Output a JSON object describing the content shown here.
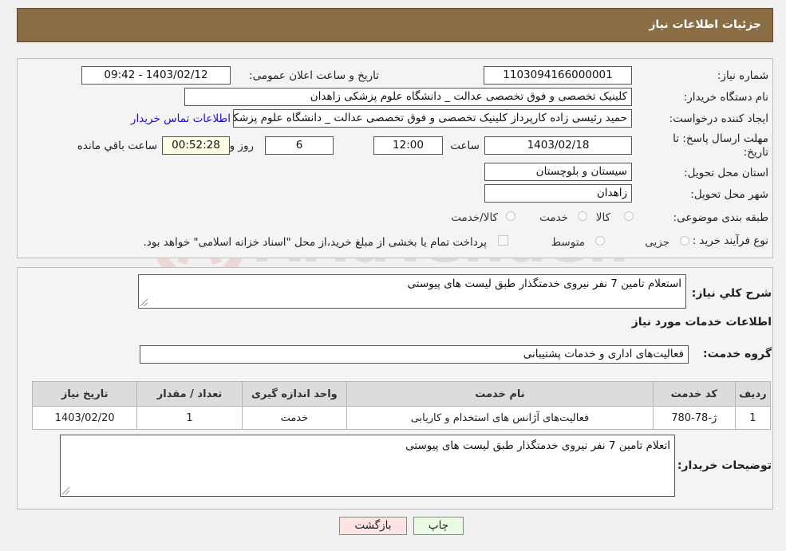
{
  "header": {
    "title": "جزئیات اطلاعات نیاز"
  },
  "form": {
    "need_number_label": "شماره نیاز:",
    "need_number": "1103094166000001",
    "announce_label": "تاریخ و ساعت اعلان عمومی:",
    "announce_value": "1403/02/12 - 09:42",
    "buyer_org_label": "نام دستگاه خریدار:",
    "buyer_org": "کلینیک تخصصی و فوق تخصصی عدالت _ دانشگاه علوم پزشکی زاهدان",
    "creator_label": "ایجاد کننده درخواست:",
    "creator": "حمید رئیسی زاده کارپرداز کلینیک تخصصی و فوق تخصصی عدالت _ دانشگاه علوم پزشکی زاهدان",
    "contact_link": "اطلاعات تماس خریدار",
    "deadline_label_1": "مهلت ارسال پاسخ: تا",
    "deadline_label_2": "تاریخ:",
    "deadline_date": "1403/02/18",
    "time_label": "ساعت",
    "deadline_time": "12:00",
    "days_value": "6",
    "days_label": "روز و",
    "remaining_value": "00:52:28",
    "remaining_label": "ساعت باقي مانده",
    "province_label": "استان محل تحویل:",
    "province": "سیستان و بلوچستان",
    "city_label": "شهر محل تحویل:",
    "city": "زاهدان",
    "category_label": "طبقه بندی موضوعی:",
    "category_options": [
      "کالا",
      "خدمت",
      "کالا/خدمت"
    ],
    "purchase_type_label": "نوع فرآیند خرید :",
    "purchase_options": [
      "جزیی",
      "متوسط"
    ],
    "payment_note": "پرداخت تمام یا بخشی از مبلغ خرید،از محل \"اسناد خزانه اسلامی\" خواهد بود."
  },
  "details": {
    "summary_label": "شرح کلي نياز:",
    "summary": "استعلام تامین 7 نفر نیروی خدمتگذار طبق لیست های پیوستی",
    "services_title": "اطلاعات خدمات مورد نياز",
    "service_group_label": "گروه خدمت:",
    "service_group": "فعالیت‌های اداری و خدمات پشتیبانی",
    "table": {
      "headers": [
        "ردیف",
        "کد خدمت",
        "نام خدمت",
        "واحد اندازه گیری",
        "تعداد / مقدار",
        "تاریخ نیاز"
      ],
      "rows": [
        [
          "1",
          "ژ-78-780",
          "فعالیت‌های آژانس های استخدام و کاریابی",
          "خدمت",
          "1",
          "1403/02/20"
        ]
      ]
    },
    "buyer_notes_label": "توضیحات خریدار:",
    "buyer_notes": "اتعلام تامین 7 نفر نیروی خدمتگذار طبق لیست های پیوستی"
  },
  "buttons": {
    "print": "چاپ",
    "back": "بازگشت"
  },
  "watermark": {
    "text": "AriaTender.neT"
  },
  "colors": {
    "header_bg": "#8a6d45",
    "link": "#1a0dcc",
    "print_btn": "#e9fbe3",
    "back_btn": "#fde3e3"
  }
}
